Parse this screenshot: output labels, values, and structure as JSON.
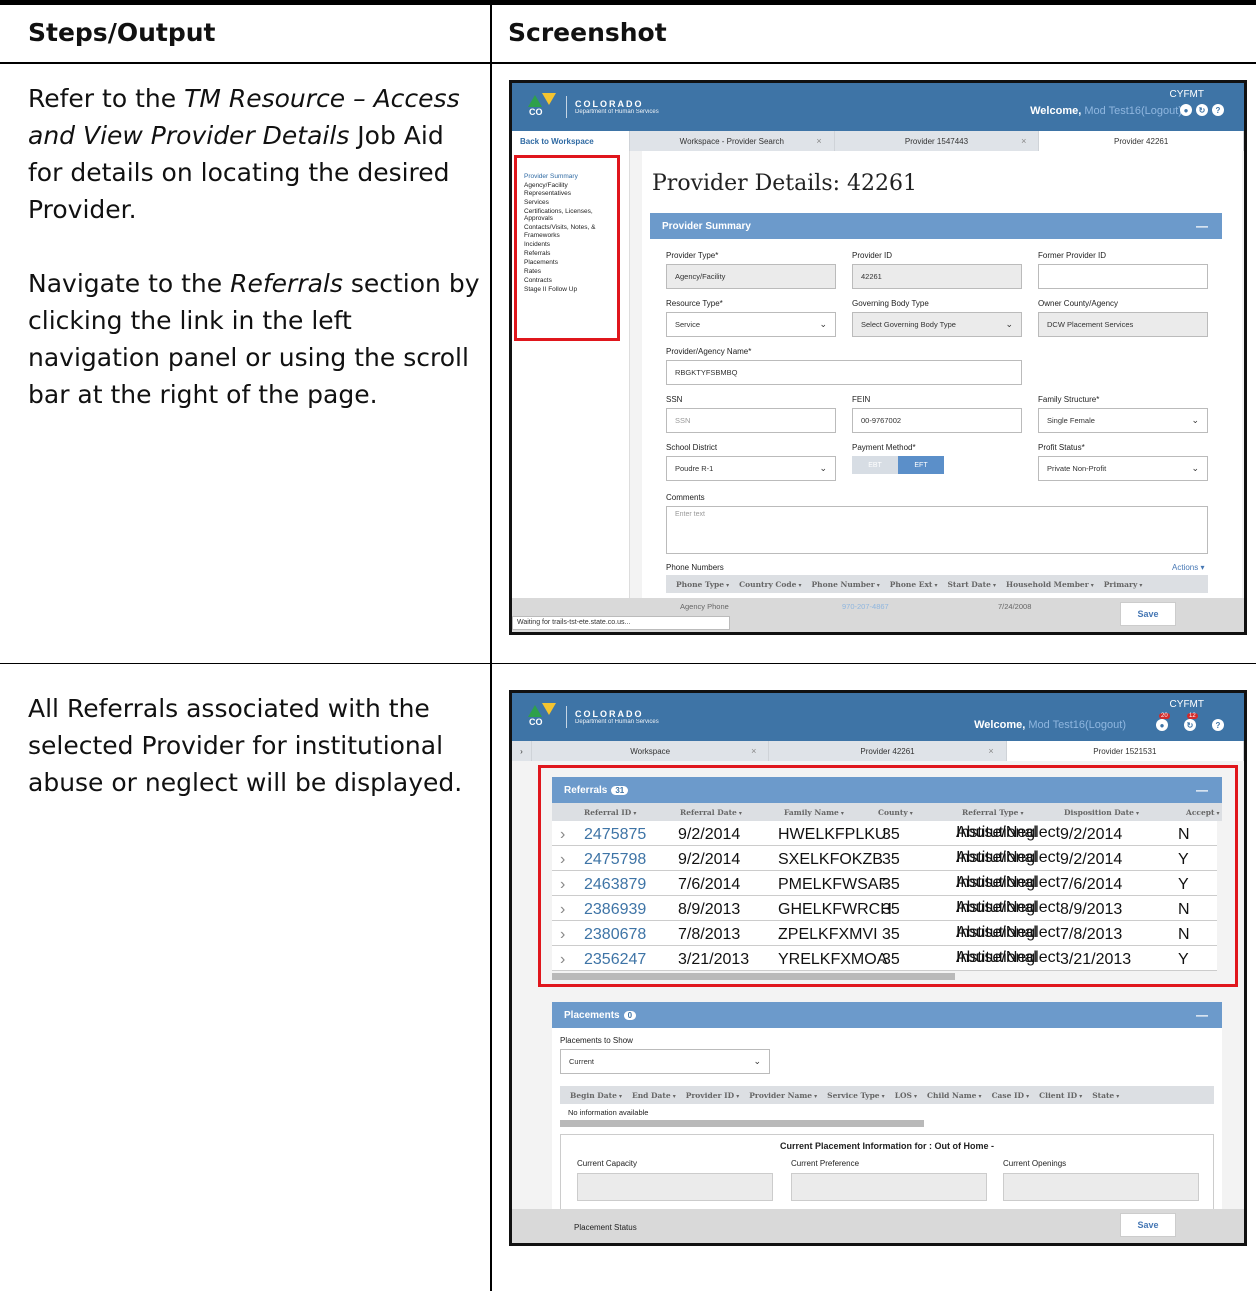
{
  "doc": {
    "col1_header": "Steps/Output",
    "col2_header": "Screenshot",
    "step1_p1_pre": "Refer to the ",
    "step1_p1_em": "TM Resource – Access and View Provider Details",
    "step1_p1_post": " Job Aid for details on locating the desired Provider.",
    "step1_p2_pre": "Navigate to the ",
    "step1_p2_em": "Referrals",
    "step1_p2_post": " section by clicking the link in the left navigation panel or using the scroll bar at the right of the page.",
    "step2_p1": "All Referrals associated with the selected Provider for institutional abuse or neglect will be displayed."
  },
  "app": {
    "logo_word": "COLORADO",
    "logo_sub": "Department of Human Services",
    "logo_co": "CO",
    "app_code": "CYFMT",
    "welcome": "Welcome,",
    "user": "Mod Test16",
    "logout": "(Logout)",
    "notif_count": "20",
    "tasks_count": "12"
  },
  "shot1": {
    "back_link": "Back to Workspace",
    "tabs": [
      "Workspace - Provider Search",
      "Provider 1547443",
      "Provider 42261"
    ],
    "nav": [
      "Provider Summary",
      "Agency/Facility Representatives",
      "Services",
      "Certifications, Licenses, Approvals",
      "Contacts/Visits, Notes, & Frameworks",
      "Incidents",
      "Referrals",
      "Placements",
      "Rates",
      "Contracts",
      "Stage II Follow Up"
    ],
    "page_title": "Provider Details: 42261",
    "section_title": "Provider Summary",
    "fields": {
      "provider_type_lbl": "Provider Type*",
      "provider_type_val": "Agency/Facility",
      "provider_id_lbl": "Provider ID",
      "provider_id_val": "42261",
      "former_id_lbl": "Former Provider ID",
      "former_id_val": "",
      "resource_type_lbl": "Resource Type*",
      "resource_type_val": "Service",
      "gov_body_lbl": "Governing Body Type",
      "gov_body_val": "Select Governing Body Type",
      "owner_lbl": "Owner County/Agency",
      "owner_val": "DCW Placement Services",
      "name_lbl": "Provider/Agency Name*",
      "name_val": "RBGKTYFSBMBQ",
      "ssn_lbl": "SSN",
      "ssn_ph": "SSN",
      "fein_lbl": "FEIN",
      "fein_val": "00-9767002",
      "family_lbl": "Family Structure*",
      "family_val": "Single Female",
      "school_lbl": "School District",
      "school_val": "Poudre R-1",
      "payment_lbl": "Payment Method*",
      "payment_off": "EBT",
      "payment_on": "EFT",
      "profit_lbl": "Profit Status*",
      "profit_val": "Private Non-Profit",
      "comments_lbl": "Comments",
      "comments_ph": "Enter text",
      "phones_lbl": "Phone Numbers",
      "actions": "Actions ▾"
    },
    "phone_cols": [
      "Phone Type",
      "Country Code",
      "Phone Number",
      "Phone Ext",
      "Start Date",
      "Household Member",
      "Primary"
    ],
    "phone_row": {
      "type": "Agency Phone",
      "number": "970-207-4867",
      "start": "7/24/2008"
    },
    "save": "Save",
    "status_text": "Waiting for trails-tst-ete.state.co.us..."
  },
  "shot2": {
    "tabs": [
      "Workspace",
      "Provider 42261",
      "Provider 1521531"
    ],
    "referrals_title": "Referrals",
    "referrals_count": "31",
    "ref_cols": [
      "Referral ID",
      "Referral Date",
      "Family Name",
      "County",
      "Referral Type",
      "Disposition Date",
      "Accept"
    ],
    "rows": [
      {
        "id": "2475875",
        "date": "9/2/2014",
        "family": "HWELKFPLKU",
        "county": "35",
        "type1": "Institutional",
        "type2": "Abuse/Neglect",
        "disp": "9/2/2014",
        "acc": "N"
      },
      {
        "id": "2475798",
        "date": "9/2/2014",
        "family": "SXELKFOKZB",
        "county": "35",
        "type1": "Institutional",
        "type2": "Abuse/Neglect",
        "disp": "9/2/2014",
        "acc": "Y"
      },
      {
        "id": "2463879",
        "date": "7/6/2014",
        "family": "PMELKFWSAF",
        "county": "35",
        "type1": "Institutional",
        "type2": "Abuse/Neglect",
        "disp": "7/6/2014",
        "acc": "Y"
      },
      {
        "id": "2386939",
        "date": "8/9/2013",
        "family": "GHELKFWRCH",
        "county": "35",
        "type1": "Institutional",
        "type2": "Abuse/Neglect",
        "disp": "8/9/2013",
        "acc": "N"
      },
      {
        "id": "2380678",
        "date": "7/8/2013",
        "family": "ZPELKFXMVI",
        "county": "35",
        "type1": "Institutional",
        "type2": "Abuse/Neglect",
        "disp": "7/8/2013",
        "acc": "N"
      },
      {
        "id": "2356247",
        "date": "3/21/2013",
        "family": "YRELKFXMOA",
        "county": "35",
        "type1": "Institutional",
        "type2": "Abuse/Neglect",
        "disp": "3/21/2013",
        "acc": "Y"
      }
    ],
    "placements_title": "Placements",
    "placements_count": "0",
    "show_lbl": "Placements to Show",
    "show_val": "Current",
    "place_cols": [
      "Begin Date",
      "End Date",
      "Provider ID",
      "Provider Name",
      "Service Type",
      "LOS",
      "Child Name",
      "Case ID",
      "Client ID",
      "State"
    ],
    "no_info": "No information available",
    "cur_info_title": "Current Placement Information for : Out of Home -",
    "cap_lbl": "Current Capacity",
    "pref_lbl": "Current Preference",
    "open_lbl": "Current Openings",
    "status_lbl": "Placement Status",
    "save": "Save"
  }
}
